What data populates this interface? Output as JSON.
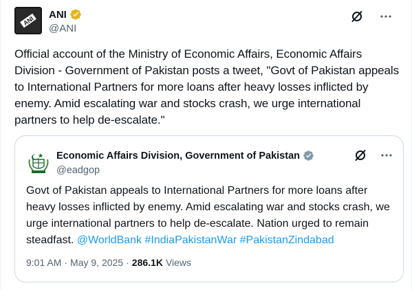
{
  "author": {
    "name": "ANI",
    "handle": "@ANI",
    "avatar_icon": "ani-logo-icon",
    "verified_color": "#e2b719"
  },
  "post": {
    "text": "Official account of the Ministry of Economic Affairs, Economic Affairs Division - Government of Pakistan posts a tweet, \"Govt of Pakistan appeals to International Partners for more loans after heavy losses inflicted by enemy. Amid escalating war and stocks crash, we urge international partners to help de-escalate.\""
  },
  "quoted": {
    "name": "Economic Affairs Division, Government of Pakistan",
    "handle": "@eadgop",
    "avatar_icon": "pakistan-emblem-icon",
    "verified_color": "#829aab",
    "text": "Govt of Pakistan appeals to International Partners for more loans after heavy losses inflicted by enemy. Amid escalating war and stocks crash, we urge international partners to help de-escalate. Nation urged to remain steadfast.",
    "links": [
      "@WorldBank",
      "#IndiaPakistanWar",
      "#PakistanZindabad"
    ],
    "time": "9:01 AM",
    "date": "May 9, 2025",
    "views_count": "286.1K",
    "views_label": "Views"
  },
  "colors": {
    "link": "#1d9bf0",
    "secondary_text": "#536471",
    "border": "#cfd9de"
  }
}
